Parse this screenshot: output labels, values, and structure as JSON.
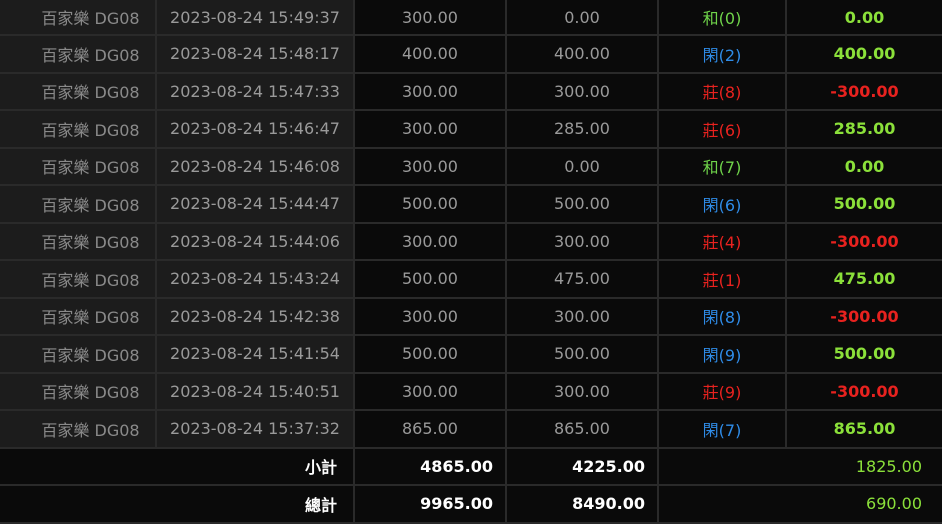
{
  "rows": [
    {
      "game": "百家樂 DG08",
      "time": "2023-08-24 15:49:37",
      "bet": "300.00",
      "valid": "0.00",
      "result": "和(0)",
      "result_type": "tie",
      "win": "0.00",
      "win_type": "zero"
    },
    {
      "game": "百家樂 DG08",
      "time": "2023-08-24 15:48:17",
      "bet": "400.00",
      "valid": "400.00",
      "result": "閑(2)",
      "result_type": "player",
      "win": "400.00",
      "win_type": "pos"
    },
    {
      "game": "百家樂 DG08",
      "time": "2023-08-24 15:47:33",
      "bet": "300.00",
      "valid": "300.00",
      "result": "莊(8)",
      "result_type": "banker",
      "win": "-300.00",
      "win_type": "neg"
    },
    {
      "game": "百家樂 DG08",
      "time": "2023-08-24 15:46:47",
      "bet": "300.00",
      "valid": "285.00",
      "result": "莊(6)",
      "result_type": "banker",
      "win": "285.00",
      "win_type": "pos"
    },
    {
      "game": "百家樂 DG08",
      "time": "2023-08-24 15:46:08",
      "bet": "300.00",
      "valid": "0.00",
      "result": "和(7)",
      "result_type": "tie",
      "win": "0.00",
      "win_type": "zero"
    },
    {
      "game": "百家樂 DG08",
      "time": "2023-08-24 15:44:47",
      "bet": "500.00",
      "valid": "500.00",
      "result": "閑(6)",
      "result_type": "player",
      "win": "500.00",
      "win_type": "pos"
    },
    {
      "game": "百家樂 DG08",
      "time": "2023-08-24 15:44:06",
      "bet": "300.00",
      "valid": "300.00",
      "result": "莊(4)",
      "result_type": "banker",
      "win": "-300.00",
      "win_type": "neg"
    },
    {
      "game": "百家樂 DG08",
      "time": "2023-08-24 15:43:24",
      "bet": "500.00",
      "valid": "475.00",
      "result": "莊(1)",
      "result_type": "banker",
      "win": "475.00",
      "win_type": "pos"
    },
    {
      "game": "百家樂 DG08",
      "time": "2023-08-24 15:42:38",
      "bet": "300.00",
      "valid": "300.00",
      "result": "閑(8)",
      "result_type": "player",
      "win": "-300.00",
      "win_type": "neg"
    },
    {
      "game": "百家樂 DG08",
      "time": "2023-08-24 15:41:54",
      "bet": "500.00",
      "valid": "500.00",
      "result": "閑(9)",
      "result_type": "player",
      "win": "500.00",
      "win_type": "pos"
    },
    {
      "game": "百家樂 DG08",
      "time": "2023-08-24 15:40:51",
      "bet": "300.00",
      "valid": "300.00",
      "result": "莊(9)",
      "result_type": "banker",
      "win": "-300.00",
      "win_type": "neg"
    },
    {
      "game": "百家樂 DG08",
      "time": "2023-08-24 15:37:32",
      "bet": "865.00",
      "valid": "865.00",
      "result": "閑(7)",
      "result_type": "player",
      "win": "865.00",
      "win_type": "pos"
    }
  ],
  "subtotal": {
    "label": "小計",
    "bet": "4865.00",
    "valid": "4225.00",
    "win": "1825.00"
  },
  "total": {
    "label": "總計",
    "bet": "9965.00",
    "valid": "8490.00",
    "win": "690.00"
  },
  "colors": {
    "tie": "#6fd34a",
    "player": "#2f8ce8",
    "banker": "#e8221f",
    "win_positive": "#8be03a",
    "win_negative": "#e8221f"
  }
}
